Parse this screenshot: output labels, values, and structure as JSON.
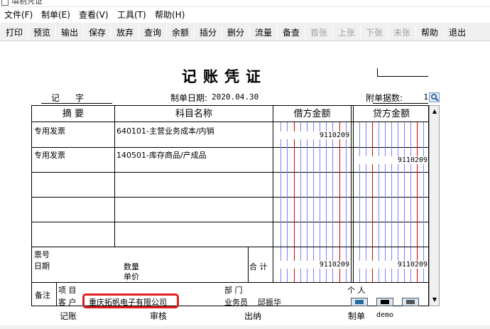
{
  "window": {
    "title": "填制凭证"
  },
  "menu": [
    "文件(F)",
    "制单(E)",
    "查看(V)",
    "工具(T)",
    "帮助(H)"
  ],
  "toolbar": {
    "buttons": [
      {
        "label": "打印",
        "enabled": true
      },
      {
        "label": "预览",
        "enabled": true
      },
      {
        "label": "输出",
        "enabled": true
      },
      {
        "label": "保存",
        "enabled": true
      },
      {
        "label": "放弃",
        "enabled": true
      },
      {
        "label": "查询",
        "enabled": true
      },
      {
        "label": "余额",
        "enabled": true
      },
      {
        "label": "插分",
        "enabled": true
      },
      {
        "label": "删分",
        "enabled": true
      },
      {
        "label": "流量",
        "enabled": true
      },
      {
        "label": "备查",
        "enabled": true
      },
      {
        "label": "首张",
        "enabled": false
      },
      {
        "label": "上张",
        "enabled": false
      },
      {
        "label": "下张",
        "enabled": false
      },
      {
        "label": "末张",
        "enabled": false
      },
      {
        "label": "帮助",
        "enabled": true
      },
      {
        "label": "退出",
        "enabled": true
      }
    ]
  },
  "voucher": {
    "title": "记账凭证",
    "type_label": "记",
    "number_label": "字",
    "date_label": "制单日期:",
    "date": "2020.04.30",
    "attachments_label": "附单据数:",
    "attachments": "1",
    "columns": {
      "summary": "摘 要",
      "account": "科目名称",
      "debit": "借方金额",
      "credit": "贷方金额"
    },
    "entries": [
      {
        "summary": "专用发票",
        "account": "640101-主营业务成本/内销",
        "debit": "9110209",
        "credit": ""
      },
      {
        "summary": "专用发票",
        "account": "140501-库存商品/产成品",
        "debit": "",
        "credit": "9110209"
      },
      {
        "summary": "",
        "account": "",
        "debit": "",
        "credit": ""
      },
      {
        "summary": "",
        "account": "",
        "debit": "",
        "credit": ""
      },
      {
        "summary": "",
        "account": "",
        "debit": "",
        "credit": ""
      }
    ],
    "bill_no_label": "票号",
    "bill_date_label": "日期",
    "qty_label": "数量",
    "price_label": "单价",
    "total_label": "合 计",
    "total_debit": "9110209",
    "total_credit": "9110209",
    "remarks_label": "备注",
    "project_label": "项 目",
    "dept_label": "部 门",
    "person_label": "个 人",
    "customer_label": "客 户",
    "customer": "重庆拓帆电子有限公司",
    "salesman_label": "业务员",
    "salesman": "邱振华"
  },
  "footer": {
    "bookkeeper_label": "记账",
    "auditor_label": "审核",
    "cashier_label": "出纳",
    "maker_label": "制单",
    "maker": "demo"
  },
  "colors": {
    "highlight": "#e02020",
    "grid_blue": "#8080ff",
    "grid_red": "#e00000"
  }
}
